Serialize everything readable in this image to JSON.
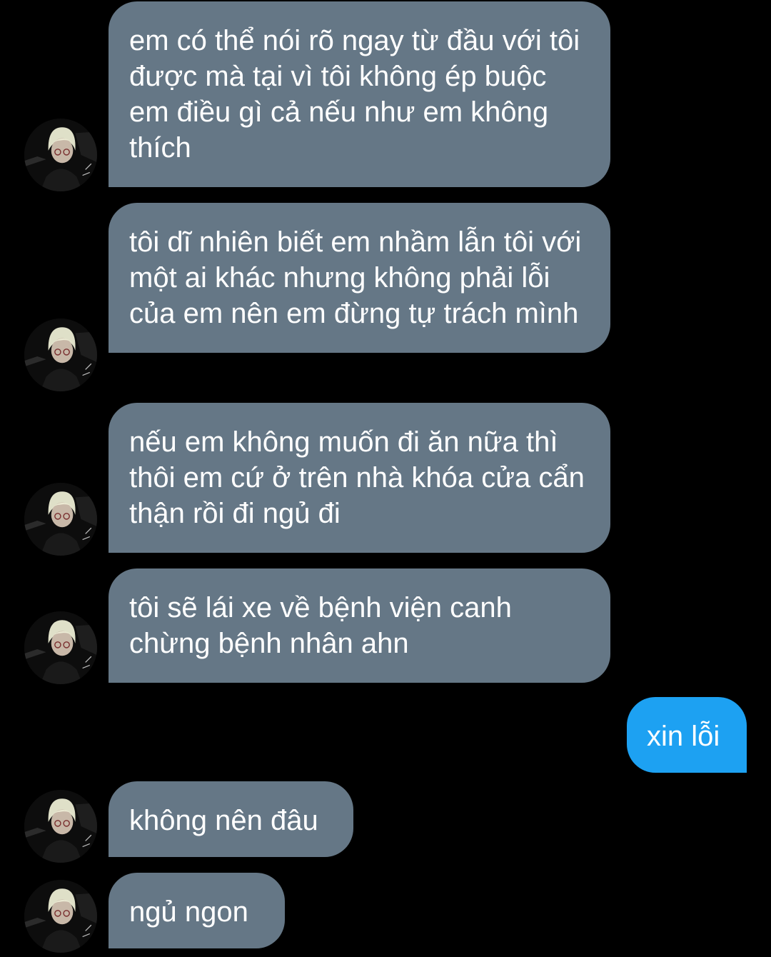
{
  "conversation": {
    "messages": [
      {
        "direction": "received",
        "text": "em có thể nói rõ ngay từ đầu với tôi được mà tại vì tôi không ép buộc em điều gì cả nếu như em không thích"
      },
      {
        "direction": "received",
        "text": "tôi dĩ nhiên biết em nhầm lẫn tôi với một ai khác nhưng không phải lỗi của em nên em đừng tự trách mình"
      },
      {
        "direction": "received",
        "text": "nếu em không muốn đi ăn nữa thì thôi em cứ ở trên nhà khóa cửa cẩn thận rồi đi ngủ đi"
      },
      {
        "direction": "received",
        "text": "tôi sẽ lái xe về bệnh viện canh chừng bệnh nhân ahn"
      },
      {
        "direction": "sent",
        "text": "xin lỗi"
      },
      {
        "direction": "received",
        "text": "không nên đâu"
      },
      {
        "direction": "received",
        "text": "ngủ ngon"
      }
    ]
  },
  "colors": {
    "background": "#000000",
    "received_bubble": "#657786",
    "sent_bubble": "#1da1f2",
    "text": "#ffffff"
  },
  "icons": {
    "avatar": "avatar-icon"
  }
}
